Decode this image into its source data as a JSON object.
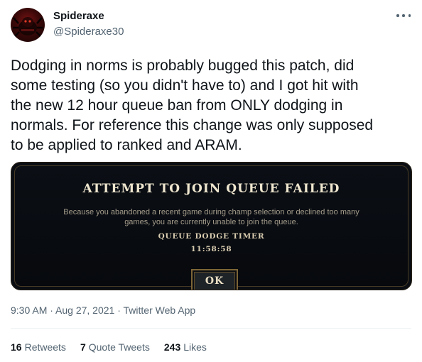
{
  "author": {
    "display_name": "Spideraxe",
    "handle": "@Spideraxe30",
    "avatar_icon": "spider-avatar-icon"
  },
  "more_icon": "more-horizontal-icon",
  "tweet": {
    "text": "Dodging in norms is probably bugged this patch, did\nsome testing (so you didn't have to) and I got hit with\nthe new 12 hour queue ban from ONLY dodging in\nnormals. For reference this change was only supposed\nto be applied to ranked and ARAM."
  },
  "media": {
    "dialog_title": "ATTEMPT TO JOIN QUEUE FAILED",
    "dialog_body": "Because you abandoned a recent game during champ selection or declined too many\ngames, you are currently unable to join the queue.",
    "timer_label": "QUEUE DODGE TIMER",
    "timer_value": "11:58:58",
    "ok_label": "OK"
  },
  "meta": {
    "timestamp": "9:30 AM · Aug 27, 2021 · Twitter Web App"
  },
  "stats": {
    "retweets_count": "16",
    "retweets_label": "Retweets",
    "quotes_count": "7",
    "quotes_label": "Quote Tweets",
    "likes_count": "243",
    "likes_label": "Likes"
  },
  "colors": {
    "text_primary": "#0f1419",
    "text_secondary": "#536471",
    "dialog_bg": "#0a0d12",
    "dialog_gold": "#7c6536"
  }
}
